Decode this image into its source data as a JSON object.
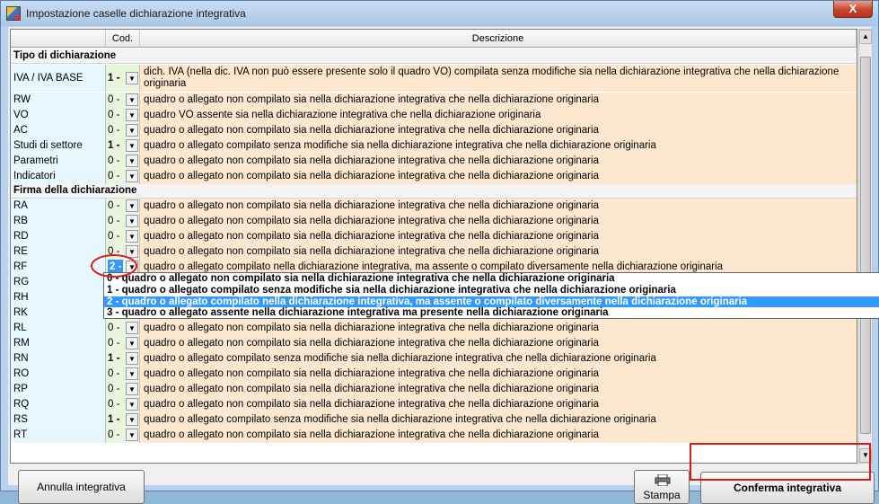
{
  "window": {
    "title": "Impostazione caselle dichiarazione integrativa",
    "close_label": "X"
  },
  "header": {
    "col_code": "Cod.",
    "col_desc": "Descrizione"
  },
  "section1": {
    "title": "Tipo di dichiarazione"
  },
  "section2": {
    "title": "Firma della dichiarazione"
  },
  "rows": [
    {
      "name": "IVA / IVA BASE",
      "code": "1 -",
      "desc": "dich. IVA (nella dic. IVA non può essere presente solo il quadro VO) compilata senza modifiche sia nella dichiarazione integrativa che nella dichiarazione originaria"
    },
    {
      "name": "RW",
      "code": "0 -",
      "desc": "quadro o allegato non compilato sia nella dichiarazione integrativa che nella dichiarazione originaria"
    },
    {
      "name": "VO",
      "code": "0 -",
      "desc": "quadro VO assente sia nella dichiarazione integrativa che nella dichiarazione originaria"
    },
    {
      "name": "AC",
      "code": "0 -",
      "desc": "quadro o allegato non compilato sia nella dichiarazione integrativa che nella dichiarazione originaria"
    },
    {
      "name": "Studi di settore",
      "code": "1 -",
      "desc": "quadro o allegato compilato senza modifiche sia nella dichiarazione integrativa che nella dichiarazione originaria"
    },
    {
      "name": "Parametri",
      "code": "0 -",
      "desc": "quadro o allegato non compilato sia nella dichiarazione integrativa che nella dichiarazione originaria"
    },
    {
      "name": "Indicatori",
      "code": "0 -",
      "desc": "quadro o allegato non compilato sia nella dichiarazione integrativa che nella dichiarazione originaria"
    },
    {
      "name": "RA",
      "code": "0 -",
      "desc": "quadro o allegato non compilato sia nella dichiarazione integrativa che nella dichiarazione originaria"
    },
    {
      "name": "RB",
      "code": "0 -",
      "desc": "quadro o allegato non compilato sia nella dichiarazione integrativa che nella dichiarazione originaria"
    },
    {
      "name": "RD",
      "code": "0 -",
      "desc": "quadro o allegato non compilato sia nella dichiarazione integrativa che nella dichiarazione originaria"
    },
    {
      "name": "RE",
      "code": "0 -",
      "desc": "quadro o allegato non compilato sia nella dichiarazione integrativa che nella dichiarazione originaria"
    },
    {
      "name": "RF",
      "code": "2 -",
      "desc": "quadro o allegato compilato nella dichiarazione integrativa, ma assente o compilato diversamente nella dichiarazione originaria"
    },
    {
      "name": "RG",
      "code": "",
      "desc": ""
    },
    {
      "name": "RH",
      "code": "",
      "desc": ""
    },
    {
      "name": "RK",
      "code": "",
      "desc": ""
    },
    {
      "name": "RL",
      "code": "0 -",
      "desc": "quadro o allegato non compilato sia nella dichiarazione integrativa che nella dichiarazione originaria"
    },
    {
      "name": "RM",
      "code": "0 -",
      "desc": "quadro o allegato non compilato sia nella dichiarazione integrativa che nella dichiarazione originaria"
    },
    {
      "name": "RN",
      "code": "1 -",
      "desc": "quadro o allegato compilato senza modifiche sia nella dichiarazione integrativa che nella dichiarazione originaria"
    },
    {
      "name": "RO",
      "code": "0 -",
      "desc": "quadro o allegato non compilato sia nella dichiarazione integrativa che nella dichiarazione originaria"
    },
    {
      "name": "RP",
      "code": "0 -",
      "desc": "quadro o allegato non compilato sia nella dichiarazione integrativa che nella dichiarazione originaria"
    },
    {
      "name": "RQ",
      "code": "0 -",
      "desc": "quadro o allegato non compilato sia nella dichiarazione integrativa che nella dichiarazione originaria"
    },
    {
      "name": "RS",
      "code": "1 -",
      "desc": "quadro o allegato compilato senza modifiche sia nella dichiarazione integrativa che nella dichiarazione originaria"
    },
    {
      "name": "RT",
      "code": "0 -",
      "desc": "quadro o allegato non compilato sia nella dichiarazione integrativa che nella dichiarazione originaria"
    }
  ],
  "dropdown": {
    "options": [
      "0 - quadro o allegato non compilato sia nella dichiarazione integrativa che nella dichiarazione originaria",
      "1 - quadro o allegato compilato senza modifiche sia nella dichiarazione integrativa che nella dichiarazione originaria",
      "2 - quadro o allegato compilato nella dichiarazione integrativa, ma assente o compilato diversamente nella dichiarazione originaria",
      "3 - quadro o allegato assente nella dichiarazione integrativa ma presente nella dichiarazione originaria"
    ],
    "selected_index": 2
  },
  "buttons": {
    "annulla": "Annulla integrativa",
    "stampa": "Stampa",
    "conferma": "Conferma integrativa"
  },
  "colors": {
    "selection": "#3399ff",
    "highlight": "#e01818",
    "desc_bg": "#fde7cf",
    "code_bg": "#e9f6de",
    "name_bg": "#e6f7ff"
  }
}
